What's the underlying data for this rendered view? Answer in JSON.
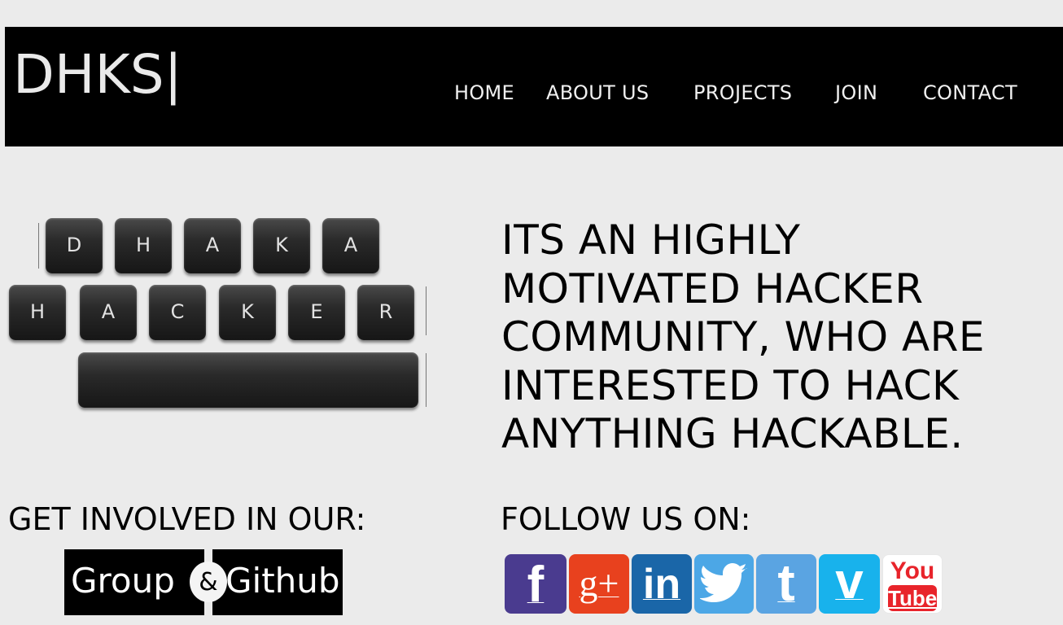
{
  "header": {
    "logo": "DHKS|",
    "nav": [
      {
        "label": "HOME"
      },
      {
        "label": "ABOUT US"
      },
      {
        "label": "PROJECTS"
      },
      {
        "label": "JOIN"
      },
      {
        "label": "CONTACT"
      }
    ]
  },
  "hero": {
    "keyboard_top_row": [
      "D",
      "H",
      "A",
      "K",
      "A"
    ],
    "keyboard_bottom_row": [
      "H",
      "A",
      "C",
      "K",
      "E",
      "R"
    ],
    "tagline_lines": [
      "ITS AN HIGHLY",
      "MOTIVATED HACKER",
      "COMMUNITY, WHO ARE",
      "INTERESTED TO HACK",
      "ANYTHING HACKABLE."
    ]
  },
  "involved": {
    "title": "GET INVOLVED IN OUR:",
    "group_label": "Group",
    "amp": "&",
    "github_label": "Github"
  },
  "follow": {
    "title": "FOLLOW US ON:",
    "icons": [
      {
        "name": "facebook-icon",
        "glyph": "f",
        "color": "#4a3b8f"
      },
      {
        "name": "google-plus-icon",
        "glyph": "g+",
        "color": "#e8411e"
      },
      {
        "name": "linkedin-icon",
        "glyph": "in",
        "color": "#1a66a8"
      },
      {
        "name": "twitter-bird-icon",
        "glyph": "",
        "color": "#4ca7e6"
      },
      {
        "name": "twitter-t-icon",
        "glyph": "t",
        "color": "#5aa4e2"
      },
      {
        "name": "vimeo-icon",
        "glyph": "v",
        "color": "#18b2ec"
      },
      {
        "name": "youtube-icon",
        "glyph_top": "You",
        "glyph_bottom": "Tube",
        "color": "#e8242b"
      }
    ]
  }
}
